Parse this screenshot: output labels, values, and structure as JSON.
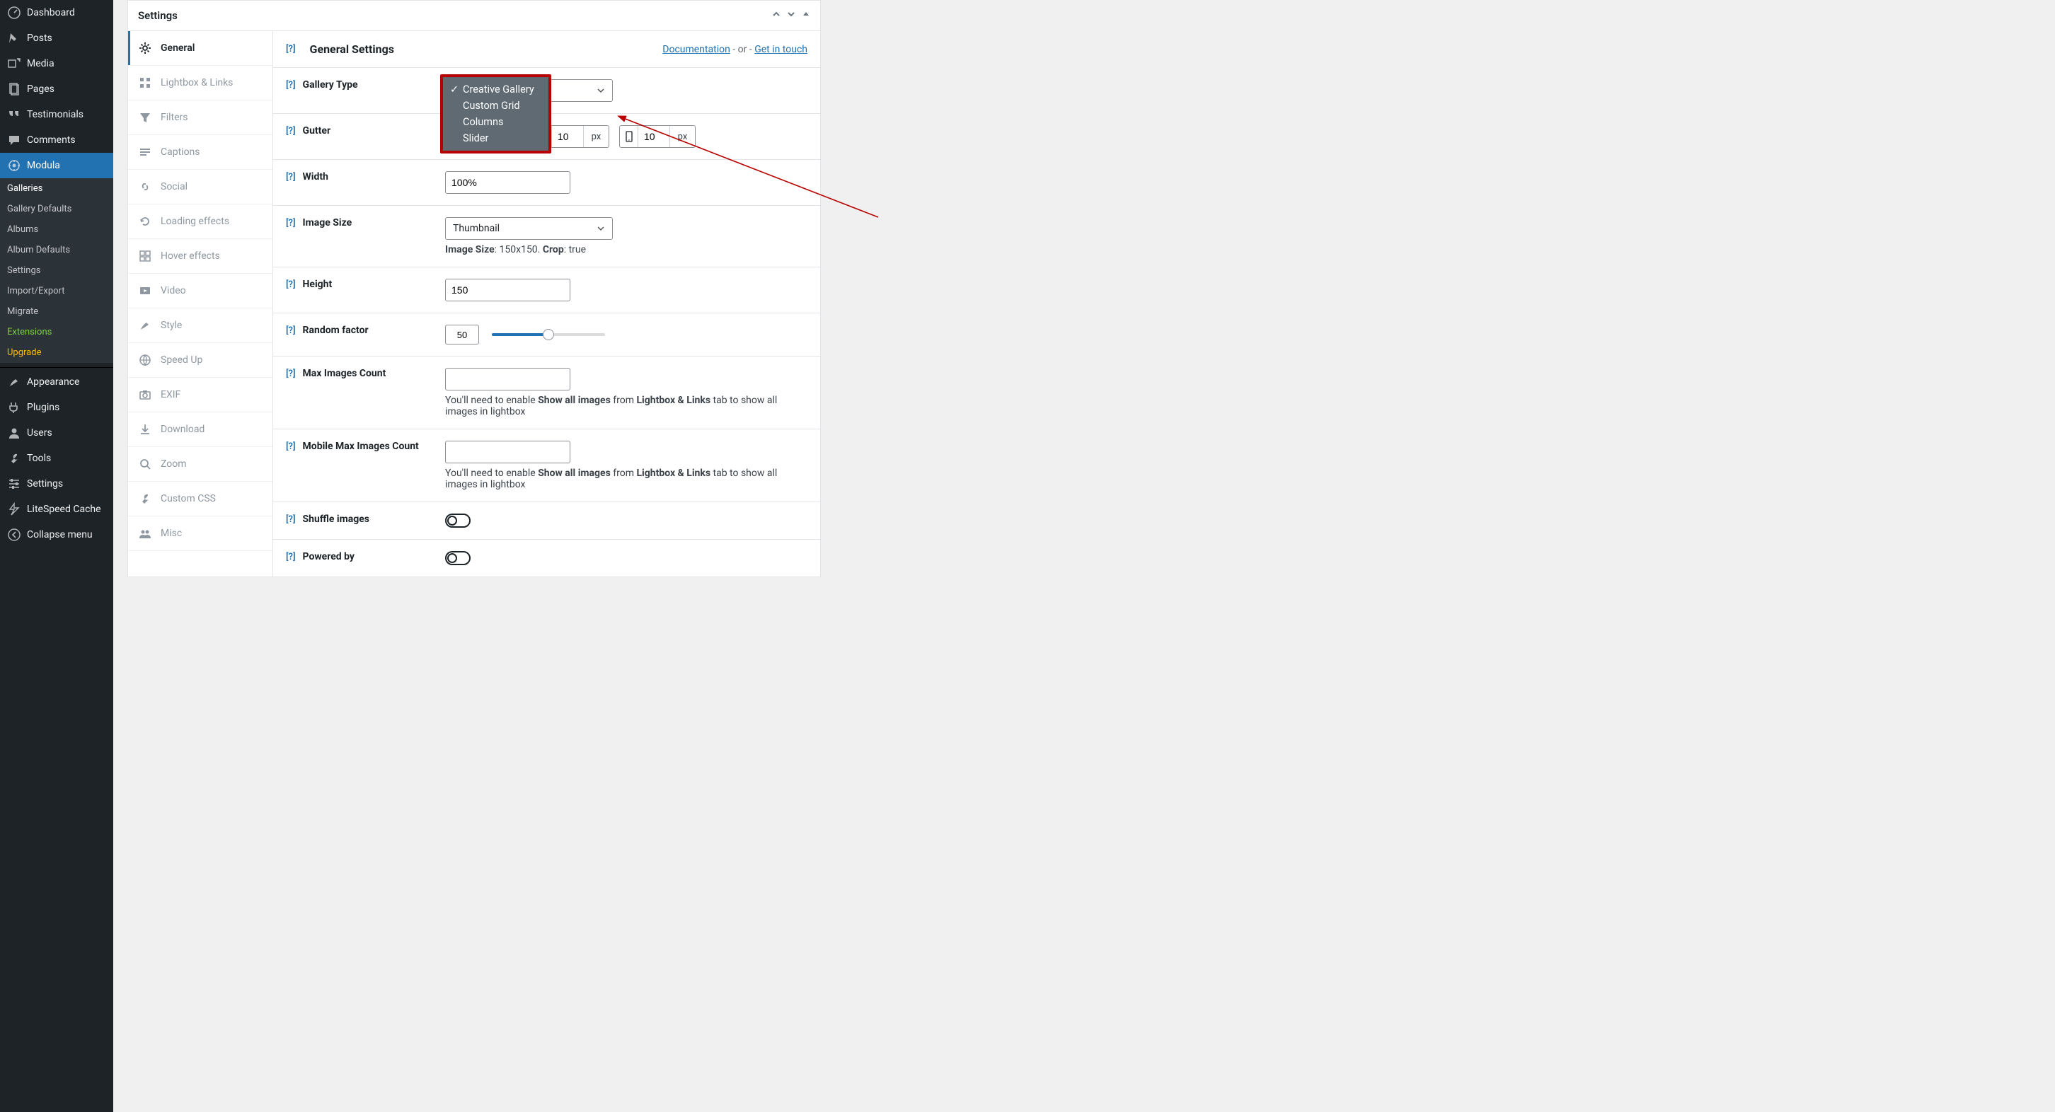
{
  "wp_menu": {
    "items": [
      {
        "label": "Dashboard",
        "icon": "dashboard"
      },
      {
        "label": "Posts",
        "icon": "pin"
      },
      {
        "label": "Media",
        "icon": "media"
      },
      {
        "label": "Pages",
        "icon": "page"
      },
      {
        "label": "Testimonials",
        "icon": "quote"
      },
      {
        "label": "Comments",
        "icon": "comment"
      },
      {
        "label": "Modula",
        "icon": "modula",
        "active": true
      }
    ],
    "submenu": [
      {
        "label": "Galleries",
        "kind": "sel"
      },
      {
        "label": "Gallery Defaults"
      },
      {
        "label": "Albums"
      },
      {
        "label": "Album Defaults"
      },
      {
        "label": "Settings"
      },
      {
        "label": "Import/Export"
      },
      {
        "label": "Migrate"
      },
      {
        "label": "Extensions",
        "kind": "ext"
      },
      {
        "label": "Upgrade",
        "kind": "upg"
      }
    ],
    "items2": [
      {
        "label": "Appearance",
        "icon": "brush"
      },
      {
        "label": "Plugins",
        "icon": "plug"
      },
      {
        "label": "Users",
        "icon": "user"
      },
      {
        "label": "Tools",
        "icon": "wrench"
      },
      {
        "label": "Settings",
        "icon": "sliders"
      },
      {
        "label": "LiteSpeed Cache",
        "icon": "litespeed"
      },
      {
        "label": "Collapse menu",
        "icon": "collapse"
      }
    ]
  },
  "panel": {
    "title": "Settings"
  },
  "tabs": [
    {
      "label": "General",
      "icon": "gear",
      "active": true
    },
    {
      "label": "Lightbox & Links",
      "icon": "grid"
    },
    {
      "label": "Filters",
      "icon": "filter"
    },
    {
      "label": "Captions",
      "icon": "captions"
    },
    {
      "label": "Social",
      "icon": "link"
    },
    {
      "label": "Loading effects",
      "icon": "refresh"
    },
    {
      "label": "Hover effects",
      "icon": "grid2"
    },
    {
      "label": "Video",
      "icon": "video"
    },
    {
      "label": "Style",
      "icon": "brush"
    },
    {
      "label": "Speed Up",
      "icon": "globe"
    },
    {
      "label": "EXIF",
      "icon": "camera"
    },
    {
      "label": "Download",
      "icon": "download"
    },
    {
      "label": "Zoom",
      "icon": "zoom"
    },
    {
      "label": "Custom CSS",
      "icon": "wrench"
    },
    {
      "label": "Misc",
      "icon": "people"
    }
  ],
  "form": {
    "heading": "General Settings",
    "doc_link": "Documentation",
    "or_text": " - or - ",
    "touch_link": "Get in touch",
    "help": "[?]",
    "gallery_type": {
      "label": "Gallery Type",
      "options": [
        "Creative Gallery",
        "Custom Grid",
        "Columns",
        "Slider"
      ],
      "selected": "Creative Gallery"
    },
    "gutter": {
      "label": "Gutter",
      "unit": "px",
      "tablet": "10",
      "mobile": "10"
    },
    "width": {
      "label": "Width",
      "value": "100%"
    },
    "image_size": {
      "label": "Image Size",
      "value": "Thumbnail",
      "note_prefix": "Image Size",
      "note_dims": ": 150x150. ",
      "note_crop_label": "Crop",
      "note_crop_val": ": true"
    },
    "height": {
      "label": "Height",
      "value": "150"
    },
    "random": {
      "label": "Random factor",
      "value": "50"
    },
    "max_images": {
      "label": "Max Images Count",
      "note_a": "You'll need to enable ",
      "note_b": "Show all images",
      "note_c": " from ",
      "note_d": "Lightbox & Links",
      "note_e": " tab to show all images in lightbox"
    },
    "mobile_max": {
      "label": "Mobile Max Images Count"
    },
    "shuffle": {
      "label": "Shuffle images"
    },
    "powered": {
      "label": "Powered by"
    }
  }
}
